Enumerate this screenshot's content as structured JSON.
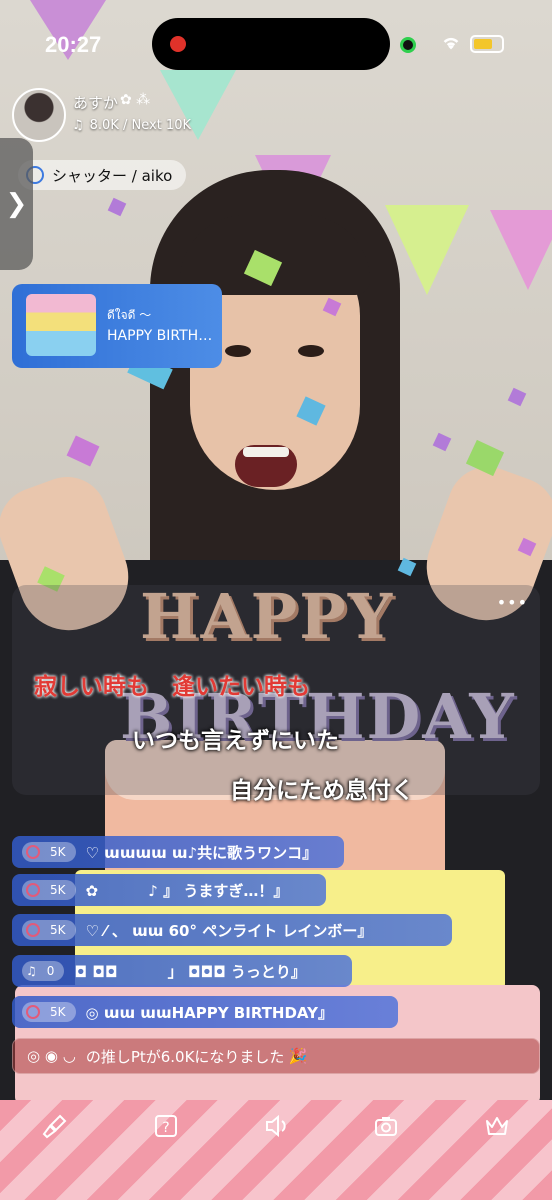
{
  "status_bar": {
    "time": "20:27"
  },
  "streamer": {
    "name": "あすか",
    "badges": "✿ ⁂",
    "points": "8.0K / Next 10K"
  },
  "song": {
    "label": "シャッター / aiko"
  },
  "gift_banner": {
    "sender": "ดีใจดี ～",
    "title": "HAPPY BIRTHD…"
  },
  "lyrics": {
    "line1": "寂しい時も　逢いたい時も",
    "line2": "いつも言えずにいた",
    "line3": "自分にため息付く"
  },
  "comments": [
    {
      "badge": "5K",
      "text": "♡ ɯɯɯɯ ɯ♪共に歌うワンコ』"
    },
    {
      "badge": "5K",
      "text": "✿ 　　　♪ 』 うますぎ…！』"
    },
    {
      "badge": "5K",
      "text": "♡ ⁄ 、 ɯɯ 60° ペンライト レインボー』"
    },
    {
      "badge": "0",
      "text": "◘ ◘◘ 　　　」 ◘◘◘ うっとり』"
    },
    {
      "badge": "5K",
      "text": "◎ ɯɯ ɯɯHAPPY BIRTHDAY』"
    }
  ],
  "system_message": {
    "text": "の推しPtが6.0Kになりました"
  },
  "birthday_overlay": {
    "line1": "HAPPY",
    "line2": "BIRTHDAY"
  },
  "colors": {
    "accent_blue": "#3d6fd8",
    "lyric_red": "#e23a35",
    "battery": "#f3c62a",
    "record": "#e0322a"
  },
  "toolbar_icons": [
    "mic-icon",
    "help-icon",
    "speaker-icon",
    "camera-flip-icon",
    "crown-icon"
  ]
}
